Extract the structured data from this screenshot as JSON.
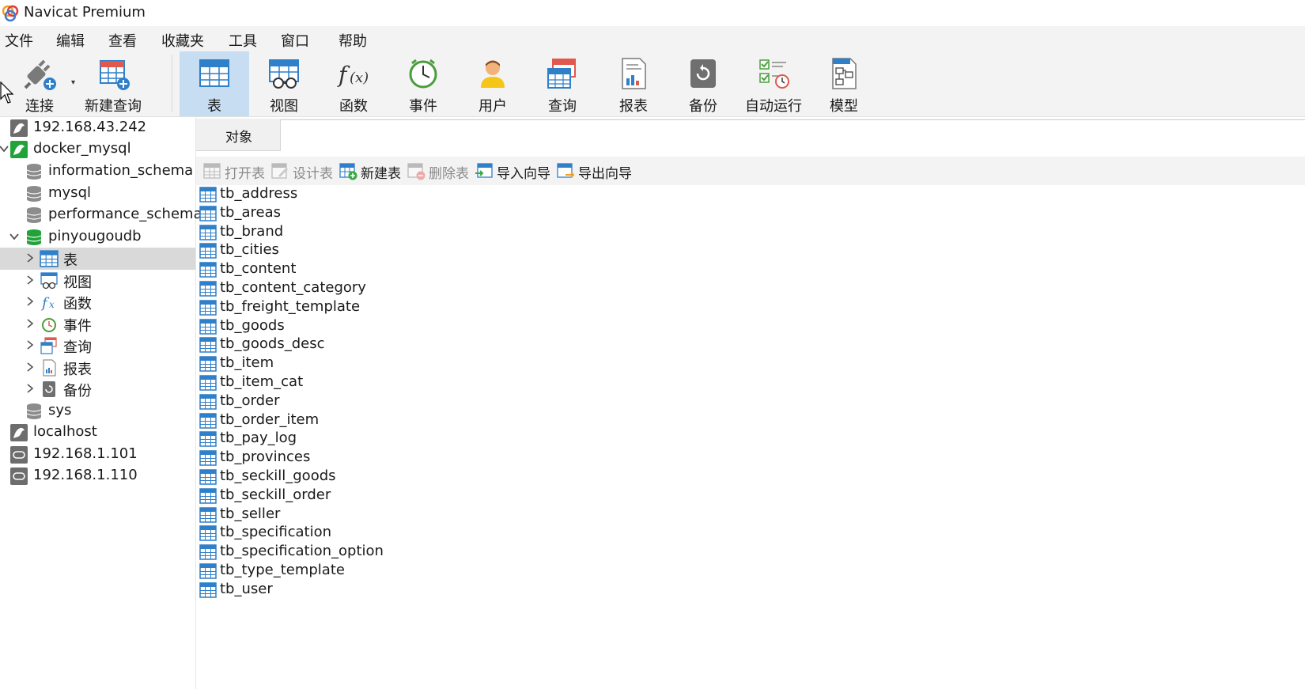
{
  "window": {
    "title": "Navicat Premium"
  },
  "menu": [
    "文件",
    "编辑",
    "查看",
    "收藏夹",
    "工具",
    "窗口",
    "帮助"
  ],
  "toolbar": {
    "connect": "连接",
    "new_query": "新建查询",
    "table": "表",
    "view": "视图",
    "function": "函数",
    "event": "事件",
    "user": "用户",
    "query": "查询",
    "report": "报表",
    "backup": "备份",
    "automation": "自动运行",
    "model": "模型",
    "active": "table"
  },
  "tree": {
    "conn1": "192.168.43.242",
    "conn2": "docker_mysql",
    "db1": "information_schema",
    "db2": "mysql",
    "db3": "performance_schema",
    "db4": "pinyougoudb",
    "node_table": "表",
    "node_view": "视图",
    "node_function": "函数",
    "node_event": "事件",
    "node_query": "查询",
    "node_report": "报表",
    "node_backup": "备份",
    "db5": "sys",
    "conn3": "localhost",
    "conn4": "192.168.1.101",
    "conn5": "192.168.1.110"
  },
  "objects_tab": "对象",
  "actions": {
    "open_table": "打开表",
    "design_table": "设计表",
    "new_table": "新建表",
    "delete_table": "删除表",
    "import_wizard": "导入向导",
    "export_wizard": "导出向导"
  },
  "tables": [
    "tb_address",
    "tb_areas",
    "tb_brand",
    "tb_cities",
    "tb_content",
    "tb_content_category",
    "tb_freight_template",
    "tb_goods",
    "tb_goods_desc",
    "tb_item",
    "tb_item_cat",
    "tb_order",
    "tb_order_item",
    "tb_pay_log",
    "tb_provinces",
    "tb_seckill_goods",
    "tb_seckill_order",
    "tb_seller",
    "tb_specification",
    "tb_specification_option",
    "tb_type_template",
    "tb_user"
  ],
  "colors": {
    "toolbar_bg": "#f3f3f3",
    "active_tool_bg": "#c7def2",
    "selected_row_bg": "#d9d9d9",
    "table_icon_blue": "#2f7fc9",
    "db_icon_green": "#22a33a"
  }
}
